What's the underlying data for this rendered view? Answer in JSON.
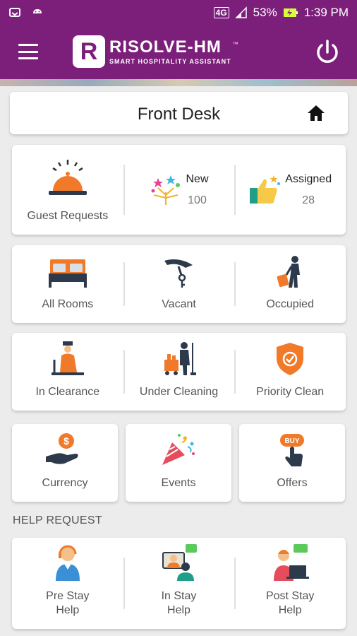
{
  "status_bar": {
    "network": "4G",
    "battery": "53%",
    "time": "1:39 PM"
  },
  "app_bar": {
    "logo_letter": "R",
    "brand": "RISOLVE-HM",
    "tagline": "SMART HOSPITALITY ASSISTANT",
    "trademark": "™"
  },
  "header": {
    "title": "Front Desk"
  },
  "requests": {
    "guest_requests": "Guest Requests",
    "new_label": "New",
    "new_count": "100",
    "assigned_label": "Assigned",
    "assigned_count": "28"
  },
  "rooms": {
    "all_rooms": "All Rooms",
    "vacant": "Vacant",
    "occupied": "Occupied"
  },
  "cleaning": {
    "in_clearance": "In Clearance",
    "under_cleaning": "Under Cleaning",
    "priority_clean": "Priority Clean"
  },
  "extras": {
    "currency": "Currency",
    "events": "Events",
    "offers": "Offers",
    "buy": "BUY"
  },
  "help": {
    "section_title": "HELP REQUEST",
    "pre_stay": "Pre Stay\nHelp",
    "in_stay": "In Stay\nHelp",
    "post_stay": "Post Stay\nHelp"
  },
  "colors": {
    "primary": "#7b1f7a",
    "accent": "#f07a2a",
    "dark": "#2d3a4b"
  }
}
